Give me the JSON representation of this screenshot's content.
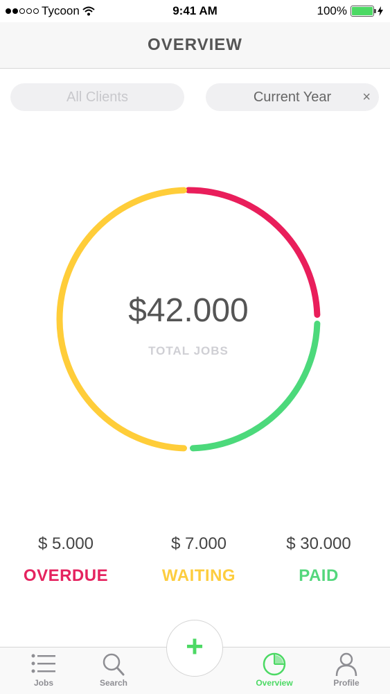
{
  "status_bar": {
    "carrier": "Tycoon",
    "time": "9:41 AM",
    "battery": "100%"
  },
  "header": {
    "title": "OVERVIEW"
  },
  "filters": {
    "clients": "All Clients",
    "period": "Current Year",
    "close": "×"
  },
  "summary": {
    "total_amount": "$42.000",
    "total_label": "TOTAL JOBS"
  },
  "stats": [
    {
      "amount": "$ 5.000",
      "label": "OVERDUE",
      "color": "#e5235f"
    },
    {
      "amount": "$ 7.000",
      "label": "WAITING",
      "color": "#fdcd3f"
    },
    {
      "amount": "$ 30.000",
      "label": "PAID",
      "color": "#54d77c"
    }
  ],
  "donut_segments": [
    {
      "name": "overdue",
      "color": "#e91e5b",
      "start_deg": 270,
      "end_deg": 358
    },
    {
      "name": "paid",
      "color": "#4cd97b",
      "start_deg": 2,
      "end_deg": 88
    },
    {
      "name": "waiting",
      "color": "#ffcd39",
      "start_deg": 92,
      "end_deg": 268
    }
  ],
  "tab_bar": {
    "jobs": "Jobs",
    "search": "Search",
    "add": "+",
    "overview": "Overview",
    "profile": "Profile"
  },
  "colors": {
    "accent": "#4cd964"
  },
  "icons": [
    "wifi-icon",
    "charging-icon",
    "close-icon",
    "list-icon",
    "search-icon",
    "plus-icon",
    "pie-chart-icon",
    "person-icon"
  ]
}
